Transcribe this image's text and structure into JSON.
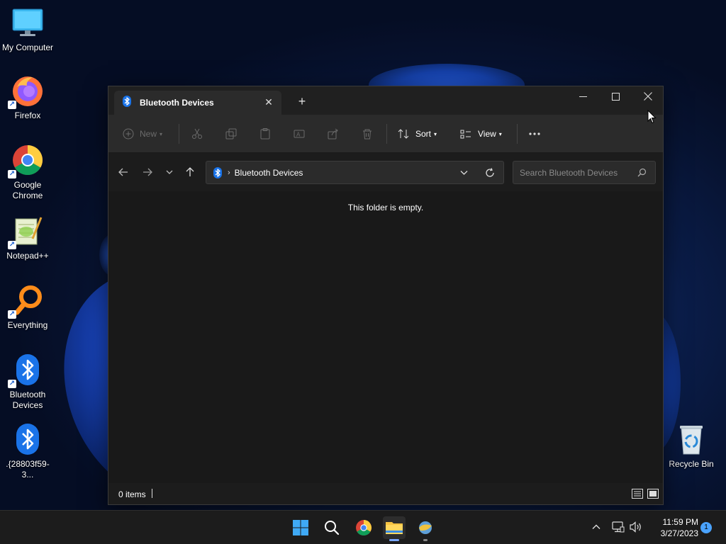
{
  "desktop": {
    "icons": [
      {
        "label": "My Computer"
      },
      {
        "label": "Firefox"
      },
      {
        "label": "Google Chrome"
      },
      {
        "label": "Notepad++"
      },
      {
        "label": "Everything"
      },
      {
        "label": "Bluetooth Devices"
      },
      {
        "label": ".{28803f59-3..."
      },
      {
        "label": "Recycle Bin"
      }
    ]
  },
  "window": {
    "tab_title": "Bluetooth Devices",
    "toolbar": {
      "new_label": "New",
      "sort_label": "Sort",
      "view_label": "View"
    },
    "address": {
      "path": "Bluetooth Devices"
    },
    "search": {
      "placeholder": "Search Bluetooth Devices"
    },
    "content": {
      "empty_message": "This folder is empty."
    },
    "status": {
      "items": "0 items"
    }
  },
  "taskbar": {
    "time": "11:59 PM",
    "date": "3/27/2023",
    "notification_count": "1"
  },
  "colors": {
    "accent": "#4aa3ff",
    "bluetooth": "#1a73e8",
    "window_bg": "#1c1c1c",
    "toolbar_bg": "#2b2b2b"
  }
}
